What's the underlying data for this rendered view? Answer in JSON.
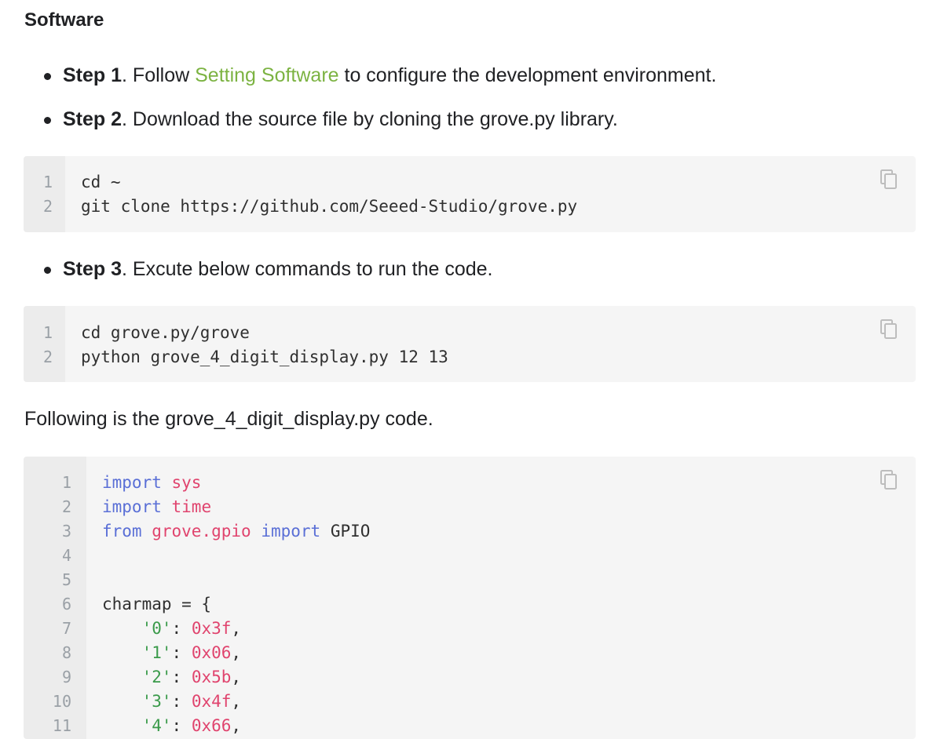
{
  "section_title": "Software",
  "steps": [
    {
      "label": "Step 1",
      "before": ". Follow ",
      "link": "Setting Software",
      "after": " to configure the development environment."
    },
    {
      "label": "Step 2",
      "text": ". Download the source file by cloning the grove.py library."
    },
    {
      "label": "Step 3",
      "text": ". Excute below commands to run the code."
    }
  ],
  "code_block_1": {
    "line_numbers": [
      "1",
      "2"
    ],
    "lines": [
      "cd ~",
      "git clone https://github.com/Seeed-Studio/grove.py"
    ]
  },
  "code_block_2": {
    "line_numbers": [
      "1",
      "2"
    ],
    "lines": [
      "cd grove.py/grove",
      "python grove_4_digit_display.py 12 13"
    ]
  },
  "paragraph": "Following is the grove_4_digit_display.py code.",
  "code_block_3": {
    "line_numbers": [
      "1",
      "2",
      "3",
      "4",
      "5",
      "6",
      "7",
      "8",
      "9",
      "10",
      "11"
    ],
    "lines": [
      {
        "tokens": [
          {
            "t": "import",
            "c": "kw"
          },
          {
            "t": " "
          },
          {
            "t": "sys",
            "c": "mod"
          }
        ]
      },
      {
        "tokens": [
          {
            "t": "import",
            "c": "kw"
          },
          {
            "t": " "
          },
          {
            "t": "time",
            "c": "mod"
          }
        ]
      },
      {
        "tokens": [
          {
            "t": "from",
            "c": "kw"
          },
          {
            "t": " "
          },
          {
            "t": "grove.gpio",
            "c": "mod"
          },
          {
            "t": " "
          },
          {
            "t": "import",
            "c": "kw"
          },
          {
            "t": " GPIO"
          }
        ]
      },
      {
        "tokens": []
      },
      {
        "tokens": []
      },
      {
        "tokens": [
          {
            "t": "charmap = {"
          }
        ]
      },
      {
        "tokens": [
          {
            "t": "    "
          },
          {
            "t": "'0'",
            "c": "str"
          },
          {
            "t": ": "
          },
          {
            "t": "0x3f",
            "c": "num"
          },
          {
            "t": ","
          }
        ]
      },
      {
        "tokens": [
          {
            "t": "    "
          },
          {
            "t": "'1'",
            "c": "str"
          },
          {
            "t": ": "
          },
          {
            "t": "0x06",
            "c": "num"
          },
          {
            "t": ","
          }
        ]
      },
      {
        "tokens": [
          {
            "t": "    "
          },
          {
            "t": "'2'",
            "c": "str"
          },
          {
            "t": ": "
          },
          {
            "t": "0x5b",
            "c": "num"
          },
          {
            "t": ","
          }
        ]
      },
      {
        "tokens": [
          {
            "t": "    "
          },
          {
            "t": "'3'",
            "c": "str"
          },
          {
            "t": ": "
          },
          {
            "t": "0x4f",
            "c": "num"
          },
          {
            "t": ","
          }
        ]
      },
      {
        "tokens": [
          {
            "t": "    "
          },
          {
            "t": "'4'",
            "c": "str"
          },
          {
            "t": ": "
          },
          {
            "t": "0x66",
            "c": "num"
          },
          {
            "t": ","
          }
        ]
      }
    ]
  },
  "copy_icon": "copy-icon",
  "colors": {
    "link": "#7cb342",
    "keyword": "#5a6fd6",
    "module": "#e0446e",
    "string": "#3a9a4a",
    "code_bg": "#f5f5f5"
  }
}
